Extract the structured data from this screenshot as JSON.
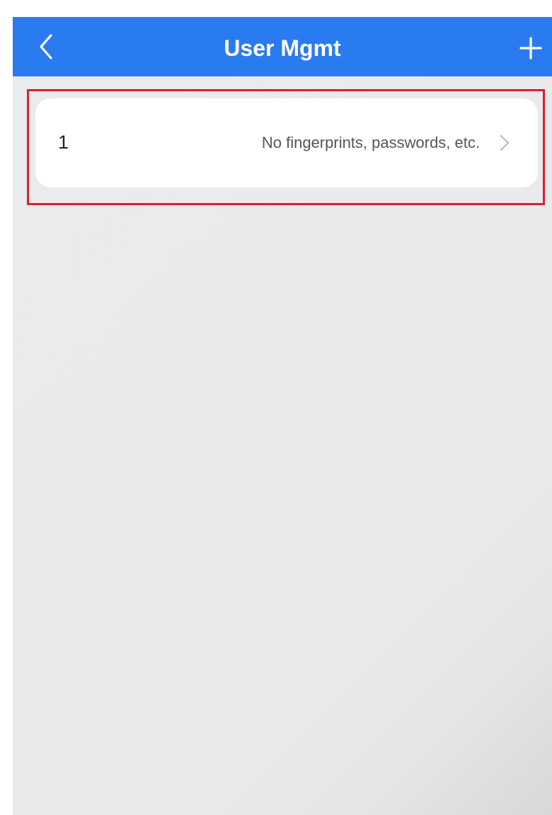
{
  "header": {
    "title": "User Mgmt",
    "back_icon": "chevron-left-icon",
    "add_icon": "plus-icon",
    "color": "#2B7BF0"
  },
  "users": [
    {
      "name": "1",
      "status": "No fingerprints, passwords, etc.",
      "icon": "chevron-right-icon"
    }
  ],
  "highlight": {
    "color": "#E11D2E"
  },
  "background_color": "#E9EBEC"
}
